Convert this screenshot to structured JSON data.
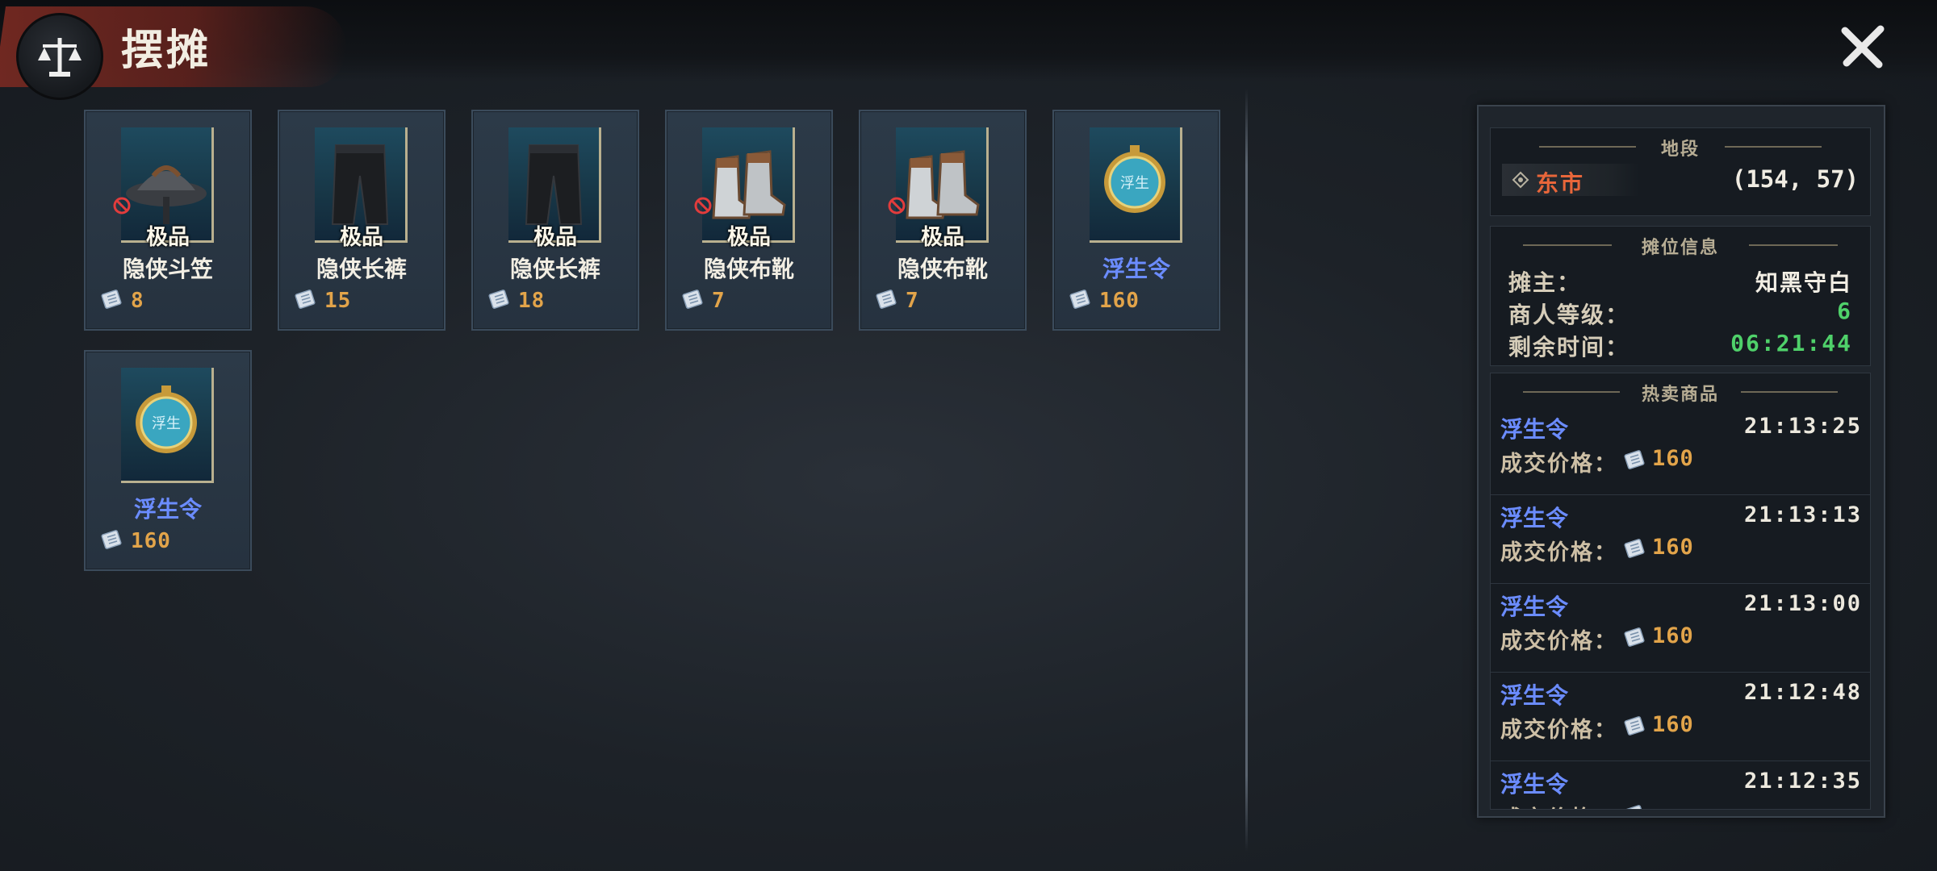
{
  "header": {
    "title": "摆摊"
  },
  "items": [
    {
      "quality": "极品",
      "name": "隐侠斗笠",
      "price": "8",
      "banned": true,
      "name_color": "white",
      "icon": "hat-icon"
    },
    {
      "quality": "极品",
      "name": "隐侠长裤",
      "price": "15",
      "banned": false,
      "name_color": "white",
      "icon": "pants-icon"
    },
    {
      "quality": "极品",
      "name": "隐侠长裤",
      "price": "18",
      "banned": false,
      "name_color": "white",
      "icon": "pants-icon"
    },
    {
      "quality": "极品",
      "name": "隐侠布靴",
      "price": "7",
      "banned": true,
      "name_color": "white",
      "icon": "boots-icon"
    },
    {
      "quality": "极品",
      "name": "隐侠布靴",
      "price": "7",
      "banned": true,
      "name_color": "white",
      "icon": "boots-icon"
    },
    {
      "quality": "",
      "name": "浮生令",
      "price": "160",
      "banned": false,
      "name_color": "blue",
      "icon": "token-icon",
      "token_text": "浮生"
    },
    {
      "quality": "",
      "name": "浮生令",
      "price": "160",
      "banned": false,
      "name_color": "blue",
      "icon": "token-icon",
      "token_text": "浮生"
    }
  ],
  "location": {
    "title": "地段",
    "area": "东市",
    "coords": "(154, 57)"
  },
  "stall": {
    "title": "摊位信息",
    "owner_label": "摊主：",
    "owner": "知黑守白",
    "level_label": "商人等级：",
    "level": "6",
    "time_label": "剩余时间：",
    "time_left": "06:21:44"
  },
  "hot": {
    "title": "热卖商品",
    "price_label": "成交价格：",
    "entries": [
      {
        "name": "浮生令",
        "time": "21:13:25",
        "price": "160"
      },
      {
        "name": "浮生令",
        "time": "21:13:13",
        "price": "160"
      },
      {
        "name": "浮生令",
        "time": "21:13:00",
        "price": "160"
      },
      {
        "name": "浮生令",
        "time": "21:12:48",
        "price": "160"
      },
      {
        "name": "浮生令",
        "time": "21:12:35",
        "price": ""
      }
    ]
  },
  "colors": {
    "accent_red": "#7a2a22",
    "price_gold": "#e2a44a",
    "name_blue": "#6b8cff",
    "level_green": "#4fd16a"
  }
}
